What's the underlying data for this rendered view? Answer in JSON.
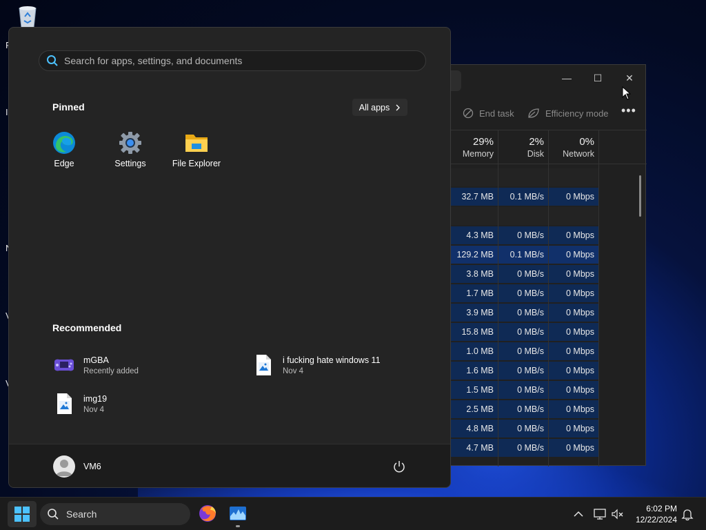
{
  "desktop": {
    "edge_letters": [
      "R",
      "I",
      "N",
      "V",
      "V"
    ]
  },
  "task_manager": {
    "window_controls": {
      "minimize": "—",
      "maximize": "☐",
      "close": "✕"
    },
    "commands": {
      "end_task": "End task",
      "efficiency_mode": "Efficiency mode",
      "more": "•••"
    },
    "columns": [
      {
        "pct": "29%",
        "label": "Memory"
      },
      {
        "pct": "2%",
        "label": "Disk"
      },
      {
        "pct": "0%",
        "label": "Network"
      }
    ],
    "rows": [
      {
        "memory": "",
        "disk": "",
        "network": "",
        "kind": "blank"
      },
      {
        "memory": "32.7 MB",
        "disk": "0.1 MB/s",
        "network": "0 Mbps",
        "kind": "hl"
      },
      {
        "memory": "",
        "disk": "",
        "network": "",
        "kind": "blank"
      },
      {
        "memory": "4.3 MB",
        "disk": "0 MB/s",
        "network": "0 Mbps",
        "kind": "hl"
      },
      {
        "memory": "129.2 MB",
        "disk": "0.1 MB/s",
        "network": "0 Mbps",
        "kind": "hl"
      },
      {
        "memory": "3.8 MB",
        "disk": "0 MB/s",
        "network": "0 Mbps",
        "kind": "hl"
      },
      {
        "memory": "1.7 MB",
        "disk": "0 MB/s",
        "network": "0 Mbps",
        "kind": "hl"
      },
      {
        "memory": "3.9 MB",
        "disk": "0 MB/s",
        "network": "0 Mbps",
        "kind": "hl"
      },
      {
        "memory": "15.8 MB",
        "disk": "0 MB/s",
        "network": "0 Mbps",
        "kind": "hl"
      },
      {
        "memory": "1.0 MB",
        "disk": "0 MB/s",
        "network": "0 Mbps",
        "kind": "hl"
      },
      {
        "memory": "1.6 MB",
        "disk": "0 MB/s",
        "network": "0 Mbps",
        "kind": "hl"
      },
      {
        "memory": "1.5 MB",
        "disk": "0 MB/s",
        "network": "0 Mbps",
        "kind": "hl"
      },
      {
        "memory": "2.5 MB",
        "disk": "0 MB/s",
        "network": "0 Mbps",
        "kind": "hl"
      },
      {
        "memory": "4.8 MB",
        "disk": "0 MB/s",
        "network": "0 Mbps",
        "kind": "hl"
      },
      {
        "memory": "4.7 MB",
        "disk": "0 MB/s",
        "network": "0 Mbps",
        "kind": "hl"
      }
    ]
  },
  "start_menu": {
    "search": {
      "placeholder": "Search for apps, settings, and documents",
      "value": ""
    },
    "pinned": {
      "title": "Pinned",
      "all_apps_label": "All apps",
      "apps": [
        {
          "label": "Edge",
          "icon": "edge-icon"
        },
        {
          "label": "Settings",
          "icon": "settings-gear-icon"
        },
        {
          "label": "File Explorer",
          "icon": "folder-icon"
        }
      ]
    },
    "recommended": {
      "title": "Recommended",
      "items": [
        {
          "name": "mGBA",
          "sub": "Recently added",
          "icon": "gameboy-advance-icon"
        },
        {
          "name": "i fucking hate windows 11",
          "sub": "Nov 4",
          "icon": "image-file-icon"
        },
        {
          "name": "img19",
          "sub": "Nov 4",
          "icon": "image-file-icon"
        }
      ]
    },
    "user": {
      "name": "VM6"
    }
  },
  "taskbar": {
    "search_label": "Search",
    "clock": {
      "time": "6:02 PM",
      "date": "12/22/2024"
    },
    "apps": [
      "firefox-icon",
      "task-manager-icon"
    ],
    "tray": [
      "chevron-up-icon",
      "network-icon",
      "volume-muted-icon",
      "notification-bell-icon"
    ]
  },
  "colors": {
    "accent": "#0078d4",
    "start_bg": "#242424",
    "taskbar_bg": "#1c1c1c",
    "tm_row_highlight": "#0f2a55"
  }
}
